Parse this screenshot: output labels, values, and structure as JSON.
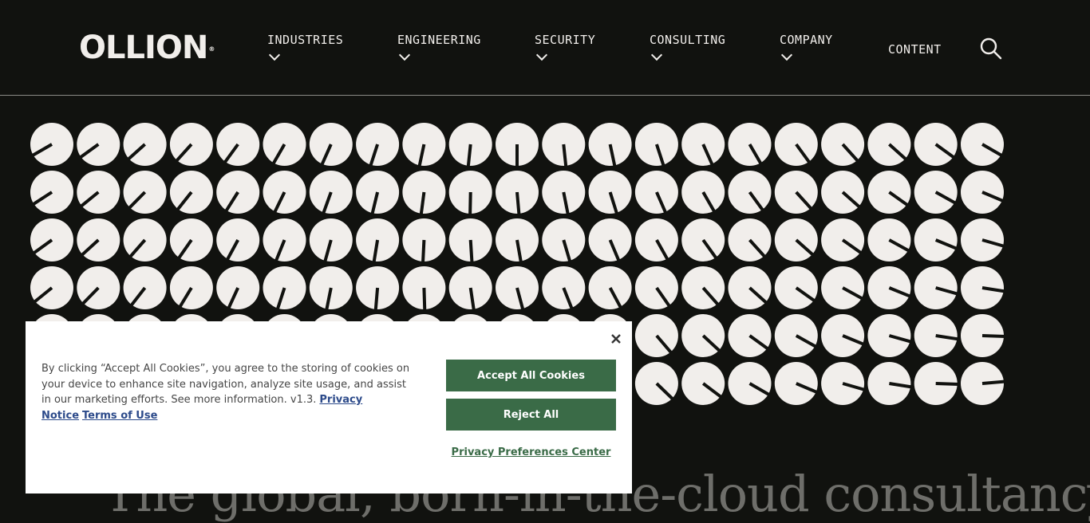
{
  "brand": {
    "name": "OLLION",
    "mark": "®"
  },
  "nav": {
    "items": [
      {
        "label": "INDUSTRIES",
        "has_dropdown": true
      },
      {
        "label": "ENGINEERING",
        "has_dropdown": true
      },
      {
        "label": "SECURITY",
        "has_dropdown": true
      },
      {
        "label": "CONSULTING",
        "has_dropdown": true
      },
      {
        "label": "COMPANY",
        "has_dropdown": true
      },
      {
        "label": "CONTENT",
        "has_dropdown": false
      }
    ],
    "search_icon": "search-icon"
  },
  "hero": {
    "art": {
      "rows": 6,
      "cols": 21,
      "dial_color": "#f1eeeb",
      "hand_color": "#11120f"
    },
    "headline": "The global, born-in-the-cloud consultancy"
  },
  "cookie": {
    "text": "By clicking “Accept All Cookies”, you agree to the storing of cookies on your device to enhance site navigation, analyze site usage, and assist in our marketing efforts. See more information. v1.3.",
    "privacy_link": "Privacy Notice",
    "terms_link": "Terms of Use",
    "accept_label": "Accept All Cookies",
    "reject_label": "Reject All",
    "preferences_label": "Privacy Preferences Center",
    "close_icon": "close-icon"
  },
  "colors": {
    "background": "#11120f",
    "text_light": "#f1eeeb",
    "button_green": "#3a6b47",
    "link_blue": "#2c4a8a"
  }
}
